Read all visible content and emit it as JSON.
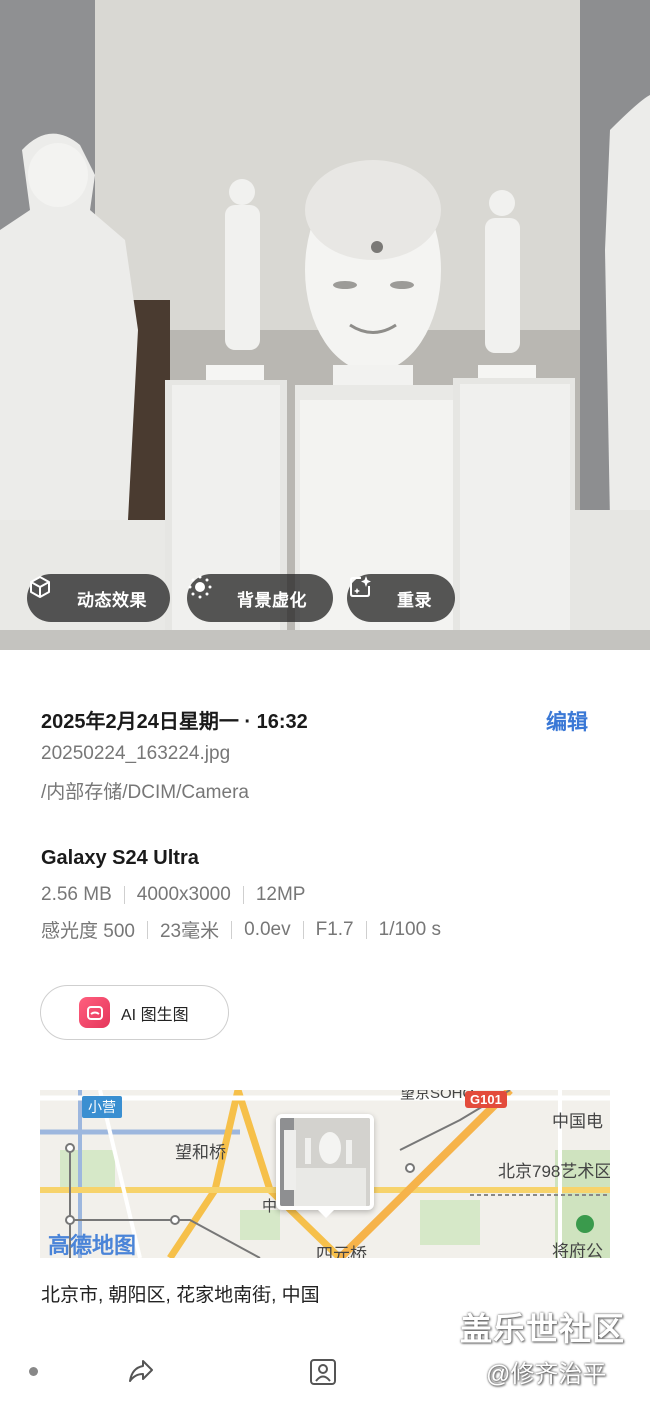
{
  "photo": {
    "actions": [
      {
        "label": "动态效果",
        "icon": "motion-effect-icon"
      },
      {
        "label": "背景虚化",
        "icon": "background-blur-icon"
      },
      {
        "label": "重录",
        "icon": "ai-remaster-icon"
      }
    ]
  },
  "details": {
    "datetime": "2025年2月24日星期一 · 16:32",
    "edit_label": "编辑",
    "filename": "20250224_163224.jpg",
    "path": "/内部存储/DCIM/Camera",
    "device": "Galaxy S24 Ultra",
    "specs_row1": [
      "2.56 MB",
      "4000x3000",
      "12MP"
    ],
    "specs_row2": [
      "感光度 500",
      "23毫米",
      "0.0ev",
      "F1.7",
      "1/100 s"
    ],
    "ai_button": "AI 图生图"
  },
  "map": {
    "labels": {
      "xiaoying": "小营",
      "wanghe": "望和桥",
      "soho": "望京SOHO",
      "g101": "G101",
      "zhongdian": "中国电",
      "art798": "北京798艺术区",
      "jiangfu": "将府公",
      "siyuan": "四元桥",
      "brand": "高德地图",
      "zhong": "中"
    }
  },
  "address": "北京市, 朝阳区, 花家地南街, 中国",
  "watermark": {
    "line1": "盖乐世社区",
    "line2": "@修齐治平"
  },
  "colors": {
    "accent": "#3a78d6",
    "chip_bg": "#282828"
  }
}
